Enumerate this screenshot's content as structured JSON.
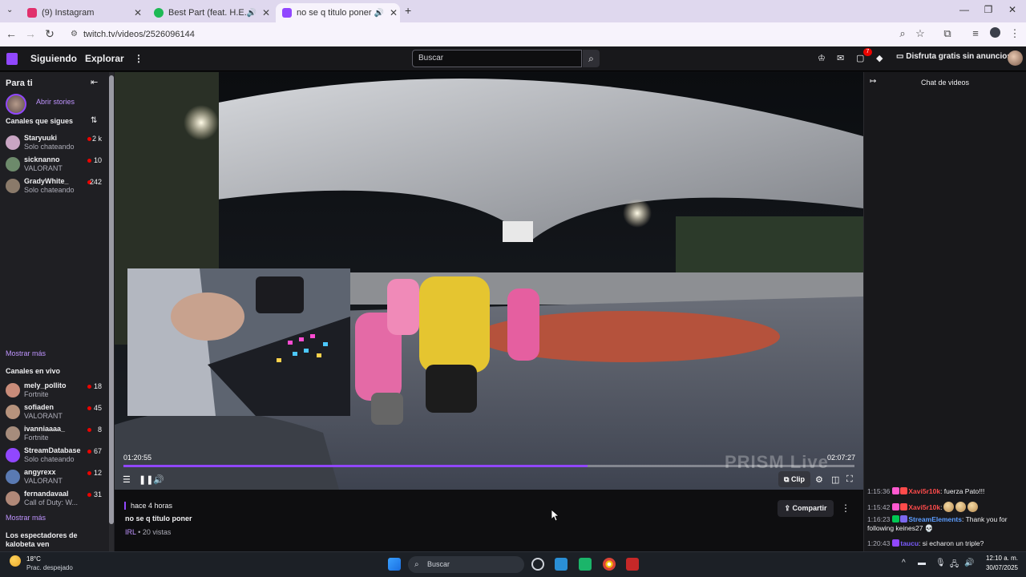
{
  "browser": {
    "tabs": [
      {
        "title": "(9) Instagram",
        "favicon_color": "#e1306c"
      },
      {
        "title": "Best Part (feat. H.E.R.) • Dan",
        "favicon_color": "#1db954"
      },
      {
        "title": "no se q titulo poner - Twitch",
        "favicon_color": "#9147ff"
      }
    ],
    "new_tab": "+",
    "url": "twitch.tv/videos/2526096144"
  },
  "twitch": {
    "nav": {
      "following": "Siguiendo",
      "browse": "Explorar",
      "search_placeholder": "Buscar",
      "notifications_count": "7",
      "ad_free": "Disfruta gratis sin anuncios"
    },
    "sidebar": {
      "for_you": "Para ti",
      "stories": "Abrir stories",
      "followed_header": "Canales que sigues",
      "followed": [
        {
          "name": "Staryuuki",
          "game": "Solo chateando",
          "viewers": "2 k",
          "color": "#c9a5c3"
        },
        {
          "name": "sicknanno",
          "game": "VALORANT",
          "viewers": "10",
          "color": "#6d8a6b"
        },
        {
          "name": "GradyWhite_",
          "game": "Solo chateando",
          "viewers": "242",
          "color": "#8a7a6a"
        }
      ],
      "show_more": "Mostrar más",
      "live_header": "Canales en vivo",
      "live": [
        {
          "name": "mely_pollito",
          "game": "Fortnite",
          "viewers": "18",
          "color": "#c98c7a"
        },
        {
          "name": "sofiaden",
          "game": "VALORANT",
          "viewers": "45",
          "color": "#b7937d"
        },
        {
          "name": "ivanniaaaa_",
          "game": "Fortnite",
          "viewers": "8",
          "color": "#a68c7c"
        },
        {
          "name": "StreamDatabase",
          "game": "Solo chateando",
          "viewers": "67",
          "color": "#9147ff"
        },
        {
          "name": "angyrexx",
          "game": "VALORANT",
          "viewers": "12",
          "color": "#5a7ab3"
        },
        {
          "name": "fernandavaal",
          "game": "Call of Duty: W...",
          "viewers": "31",
          "color": "#b08878"
        }
      ],
      "show_more_2": "Mostrar más",
      "viewers_also": "Los espectadores de kalobeta ven"
    },
    "player": {
      "time_current": "01:20:55",
      "time_total": "02:07:27",
      "progress": 0.635,
      "clip": "Clip",
      "watermark": "PRISM Live"
    },
    "video_info": {
      "ago": "hace 4 horas",
      "title": "no se q titulo poner",
      "category": "IRL",
      "views": " • 20 vistas",
      "share": "Compartir"
    },
    "chat": {
      "header": "Chat de videos",
      "messages": [
        {
          "time": "1:15:36",
          "user": "Xavi5r10k",
          "user_color": "#ff4b4b",
          "text": ": fuerza Pato!!!",
          "badges": [
            "#ff59d0",
            "#ff4b4b"
          ],
          "emotes": 0
        },
        {
          "time": "1:15:42",
          "user": "Xavi5r10k",
          "user_color": "#ff4b4b",
          "text": ":",
          "badges": [
            "#ff59d0",
            "#ff4b4b"
          ],
          "emotes": 3
        },
        {
          "time": "1:16:23",
          "user": "StreamElements",
          "user_color": "#5c9dff",
          "text": ": Thank you for following keines27 💀",
          "badges": [
            "#00c853",
            "#7b68ee"
          ],
          "emotes": 0
        },
        {
          "time": "1:20:43",
          "user": "taucu",
          "user_color": "#7b5cff",
          "text": ": si echaron un triple?",
          "badges": [
            "#9147ff"
          ],
          "emotes": 0
        }
      ]
    }
  },
  "taskbar": {
    "temp": "18°C",
    "condition": "Prac. despejado",
    "search": "Buscar",
    "time": "12:10 a. m.",
    "date": "30/07/2025"
  }
}
